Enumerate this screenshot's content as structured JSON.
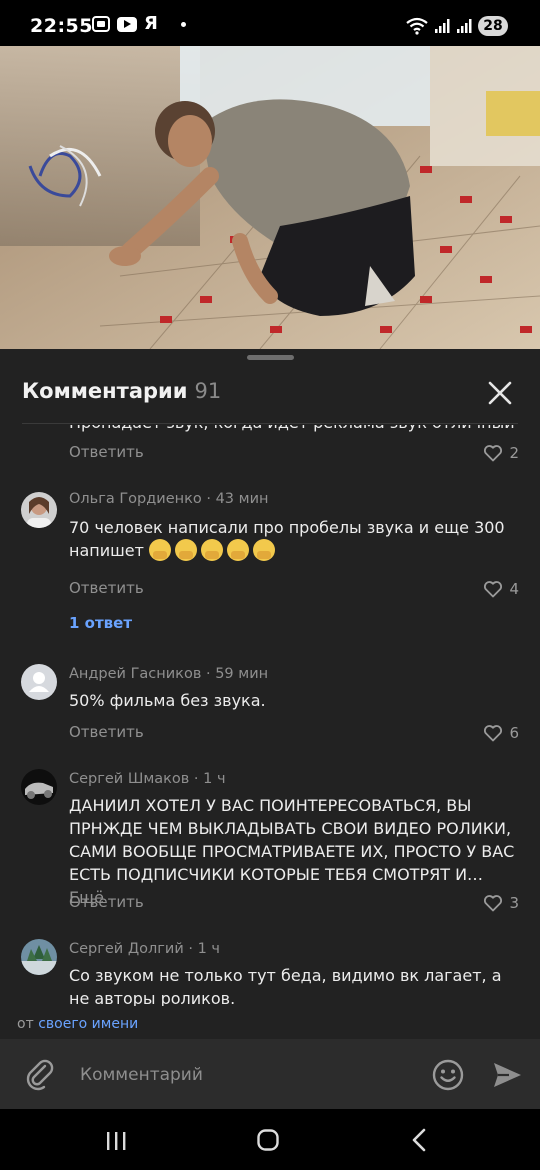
{
  "status_bar": {
    "time": "22:55",
    "app_icons": [
      "screen-record-icon",
      "youtube-icon",
      "yandex-icon"
    ],
    "yandex_letter": "Я",
    "battery": "28"
  },
  "video": {
    "description_icon": "video-thumbnail"
  },
  "comments_panel": {
    "title": "Комментарии",
    "count": "91",
    "comments": [
      {
        "author": "",
        "text": "Пропадает звук, когда идет реклама звук отличный",
        "reply_label": "Ответить",
        "likes": "2"
      },
      {
        "author": "Ольга Гордиенко · 43 мин",
        "text": "70 человек написали про пробелы звука и еще 300 напишет",
        "emoji_count": 5,
        "reply_label": "Ответить",
        "likes": "4",
        "replies_link": "1 ответ"
      },
      {
        "author": "Андрей Гасников · 59 мин",
        "text": "50% фильма без звука.",
        "reply_label": "Ответить",
        "likes": "6"
      },
      {
        "author": "Сергей Шмаков · 1 ч",
        "text": "ДАНИИЛ ХОТЕЛ У ВАС ПОИНТЕРЕСОВАТЬСЯ, ВЫ ПРНЖДЕ ЧЕМ ВЫКЛАДЫВАТЬ СВОИ ВИДЕО РОЛИКИ, САМИ ВООБЩЕ ПРОСМАТРИВАЕТЕ ИХ, ПРОСТО У ВАС ЕСТЬ ПОДПИСЧИКИ КОТОРЫЕ ТЕБЯ СМОТРЯТ И…",
        "more_label": "Ещё",
        "reply_label": "Ответить",
        "likes": "3"
      },
      {
        "author": "Сергей Долгий · 1 ч",
        "text": "Со звуком не только тут беда, видимо вк лагает, а не авторы роликов."
      }
    ],
    "from_prefix": "от",
    "from_name": "своего имени",
    "compose_placeholder": "Комментарий"
  },
  "colors": {
    "sheet_bg": "#222222",
    "accent": "#6aa3ff",
    "muted": "#909090"
  }
}
